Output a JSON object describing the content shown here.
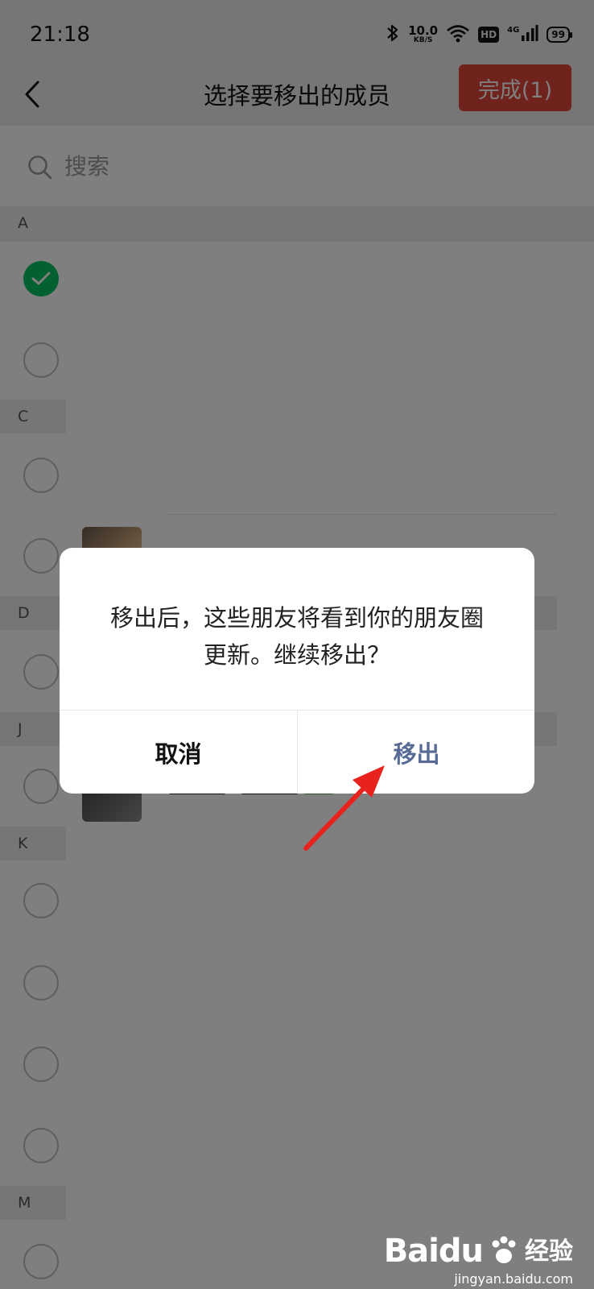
{
  "status_bar": {
    "time": "21:18",
    "speed_value": "10.0",
    "speed_unit": "KB/S",
    "hd_badge": "HD",
    "network": "4G",
    "battery": "99"
  },
  "header": {
    "title": "选择要移出的成员",
    "done_label": "完成(1)",
    "accent_color": "#e0463a"
  },
  "search": {
    "placeholder": "搜索"
  },
  "sections": [
    {
      "letter": "A",
      "rows": [
        {
          "checked": true
        },
        {
          "checked": false
        }
      ]
    },
    {
      "letter": "C",
      "rows": [
        {
          "checked": false
        },
        {
          "checked": false
        }
      ]
    },
    {
      "letter": "D",
      "rows": [
        {
          "checked": false
        }
      ]
    },
    {
      "letter": "J",
      "rows": [
        {
          "checked": false
        }
      ]
    },
    {
      "letter": "K",
      "rows": [
        {
          "checked": false
        },
        {
          "checked": false
        },
        {
          "checked": false
        },
        {
          "checked": false
        }
      ]
    },
    {
      "letter": "M",
      "rows": [
        {
          "checked": false
        }
      ]
    }
  ],
  "dialog": {
    "message": "移出后，这些朋友将看到你的朋友圈更新。继续移出？",
    "cancel_label": "取消",
    "confirm_label": "移出",
    "confirm_color": "#576b95"
  },
  "watermark": {
    "logo": "Baidu",
    "suffix": "经验",
    "url": "jingyan.baidu.com"
  }
}
